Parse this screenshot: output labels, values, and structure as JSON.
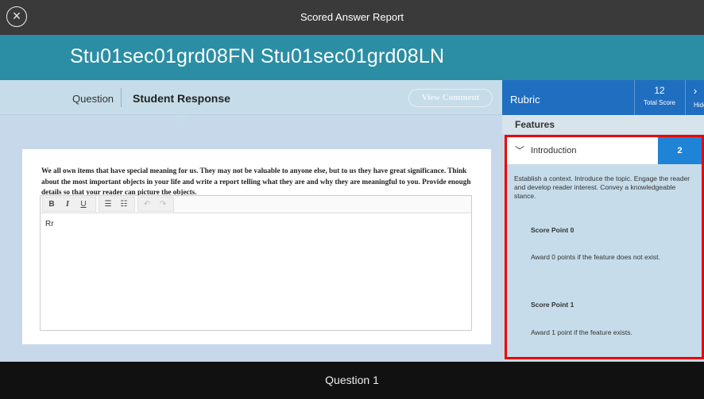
{
  "header": {
    "title": "Scored Answer Report",
    "close_icon": "close-icon"
  },
  "student": {
    "name": "Stu01sec01grd08FN Stu01sec01grd08LN"
  },
  "tabs": {
    "question": "Question",
    "student_response": "Student Response",
    "view_comment": "View Comment"
  },
  "prompt": {
    "text": "We all own items that have special meaning for us. They may not be valuable to anyone else, but to us they have great significance. Think about the most important objects in your life and write a report telling what they are and why they are meaningful to you. Provide enough details so that your reader can picture the objects."
  },
  "editor": {
    "toolbar": {
      "bold": "B",
      "italic": "I",
      "underline": "U",
      "bullets": "☰",
      "numbers": "☷",
      "undo": "↶",
      "redo": "↷"
    },
    "content": "Rr"
  },
  "rubric": {
    "label": "Rubric",
    "total_score": "12",
    "total_score_label": "Total Score",
    "hide_label": "Hide"
  },
  "features": {
    "label": "Features",
    "items": [
      {
        "label": "Introduction",
        "score": "2",
        "description": "Establish a context. Introduce the topic. Engage the reader and develop reader interest. Convey a knowledgeable stance.",
        "score_points": [
          {
            "title": "Score Point 0",
            "desc": "Award 0 points if the feature does not exist."
          },
          {
            "title": "Score Point 1",
            "desc": "Award 1 point if the feature exists."
          }
        ]
      }
    ]
  },
  "footer": {
    "label": "Question 1"
  },
  "colors": {
    "accent": "#2b8ea4",
    "rubric_blue": "#1f6ec0",
    "highlight": "#ee0000"
  }
}
